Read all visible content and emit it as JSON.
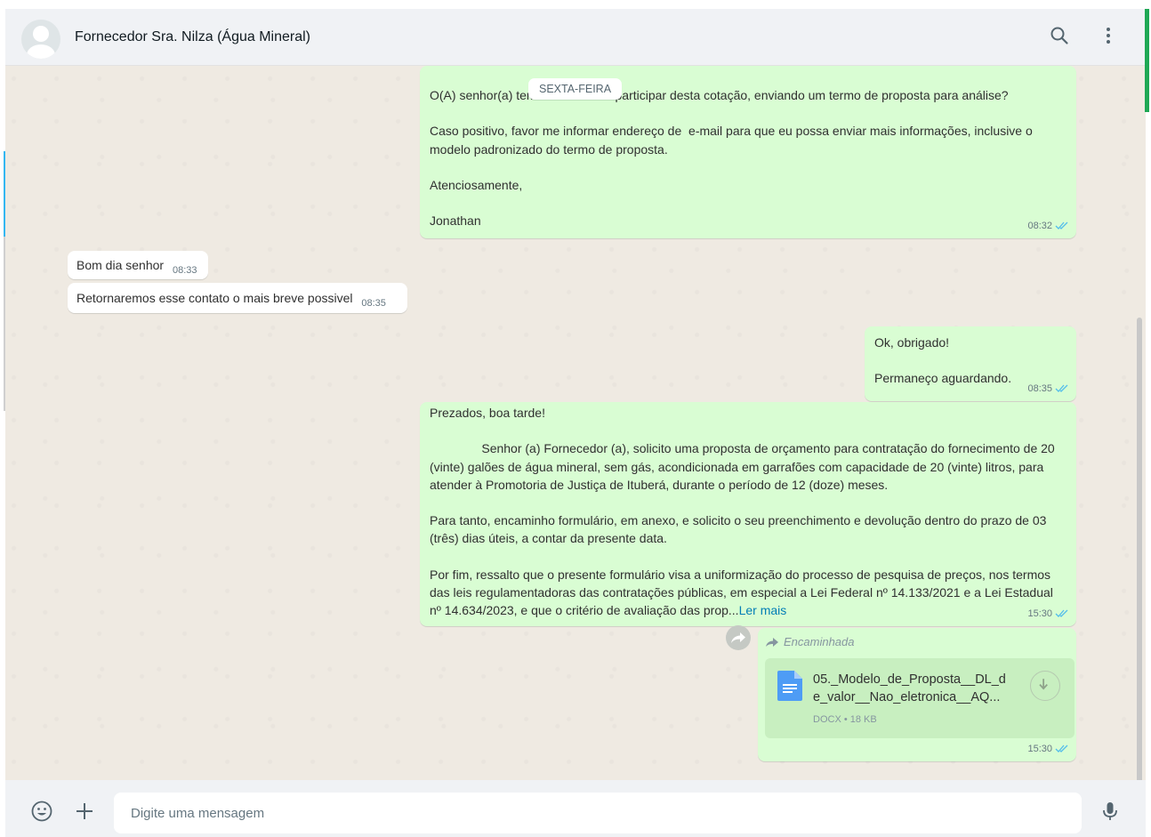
{
  "header": {
    "contact_name": "Fornecedor Sra. Nilza (Água Mineral)",
    "icons": [
      "search-icon",
      "menu-icon"
    ]
  },
  "date_pill": "SEXTA-FEIRA",
  "messages": [
    {
      "id": "m1",
      "direction": "out",
      "lines": [
        "O(A) senhor(a) tem interesse em participar desta cotação, enviando um termo de proposta para análise?",
        "Caso positivo, favor me informar endereço de  e-mail para que eu possa enviar mais informações, inclusive o modelo padronizado do termo de proposta.",
        "Atenciosamente,",
        "Jonathan"
      ],
      "time": "08:32",
      "status": "read"
    },
    {
      "id": "m2",
      "direction": "in",
      "text": "Bom dia senhor",
      "time": "08:33"
    },
    {
      "id": "m3",
      "direction": "in",
      "text": "Retornaremos esse contato o mais breve possivel",
      "time": "08:35"
    },
    {
      "id": "m4",
      "direction": "out",
      "lines": [
        "Ok, obrigado!",
        "Permaneço aguardando."
      ],
      "time": "08:35",
      "status": "read"
    },
    {
      "id": "m5",
      "direction": "out",
      "lines": [
        "Prezados, boa tarde!",
        "               Senhor (a) Fornecedor (a), solicito uma proposta de orçamento para contratação do fornecimento de 20 (vinte) galões de água mineral, sem gás, acondicionada em garrafões com capacidade de 20 (vinte) litros, para atender à Promotoria de Justiça de Ituberá, durante o período de 12 (doze) meses.",
        "Para tanto, encaminho formulário, em anexo, e solicito o seu preenchimento e devolução dentro do prazo de 03 (três) dias úteis, a contar da presente data.",
        "Por fim, ressalto que o presente formulário visa a uniformização do processo de pesquisa de preços, nos termos das leis regulamentadoras das contratações públicas, em especial a Lei Federal nº 14.133/2021 e a Lei Estadual nº 14.634/2023, e que o critério de avaliação das prop..."
      ],
      "read_more": "Ler mais",
      "time": "15:30",
      "status": "read"
    },
    {
      "id": "m6",
      "direction": "out",
      "forwarded_label": "Encaminhada",
      "document": {
        "name": "05._Modelo_de_Proposta__DL_de_valor__Nao_eletronica__AQ...",
        "name_line1": "05._Modelo_de_Proposta__DL_d",
        "name_line2": "e_valor__Nao_eletronica__AQ...",
        "info": "DOCX • 18 KB"
      },
      "time": "15:30",
      "status": "read"
    }
  ],
  "footer": {
    "placeholder": "Digite uma mensagem",
    "icons": [
      "emoji-icon",
      "plus-icon",
      "microphone-icon"
    ]
  },
  "colors": {
    "outgoing_bubble": "#d9fdd3",
    "incoming_bubble": "#ffffff",
    "chat_background": "#efeae2",
    "read_ticks": "#53bdeb",
    "link": "#027eb5"
  }
}
